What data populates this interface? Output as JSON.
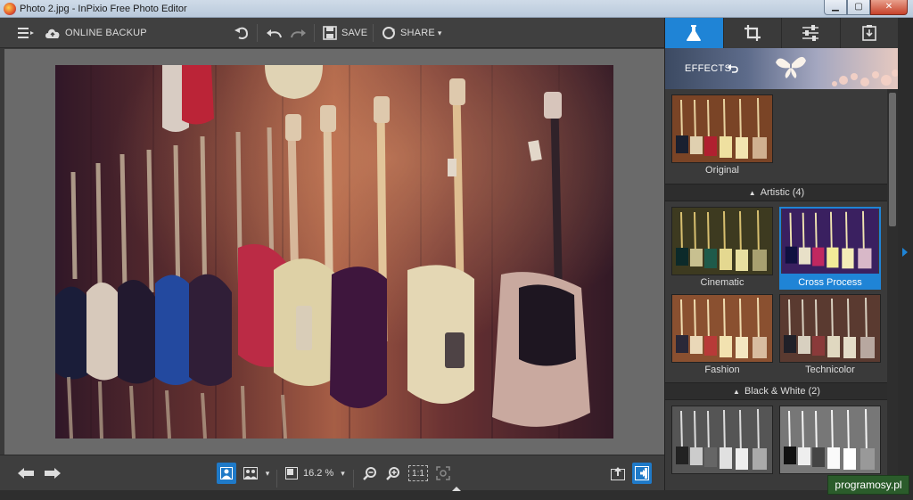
{
  "window": {
    "title": "Photo 2.jpg - InPixio Free Photo Editor",
    "min_label": "▁",
    "max_label": "▢",
    "close_label": "✕"
  },
  "toolbar": {
    "backup_label": "ONLINE BACKUP",
    "save_label": "SAVE",
    "share_label": "SHARE",
    "share_caret": "▾"
  },
  "bottombar": {
    "zoom_value": "16.2 %",
    "zoom_caret": "▾",
    "fit_label": "1:1"
  },
  "panel": {
    "tabs": [
      "effects-tab",
      "crop-tab",
      "adjust-tab",
      "export-tab"
    ],
    "effects_title": "EFFECTS",
    "original_label": "Original",
    "sections": [
      {
        "title": "Artistic (4)",
        "items": [
          "Cinematic",
          "Cross Process",
          "Fashion",
          "Technicolor"
        ]
      },
      {
        "title": "Black & White (2)",
        "items": [
          "",
          ""
        ]
      }
    ],
    "selected_item": "Cross Process"
  },
  "watermark": "programosy.pl",
  "colors": {
    "accent": "#1f84d6",
    "panel_bg": "#3a3a3a",
    "canvas_bg": "#6a6a6a"
  }
}
